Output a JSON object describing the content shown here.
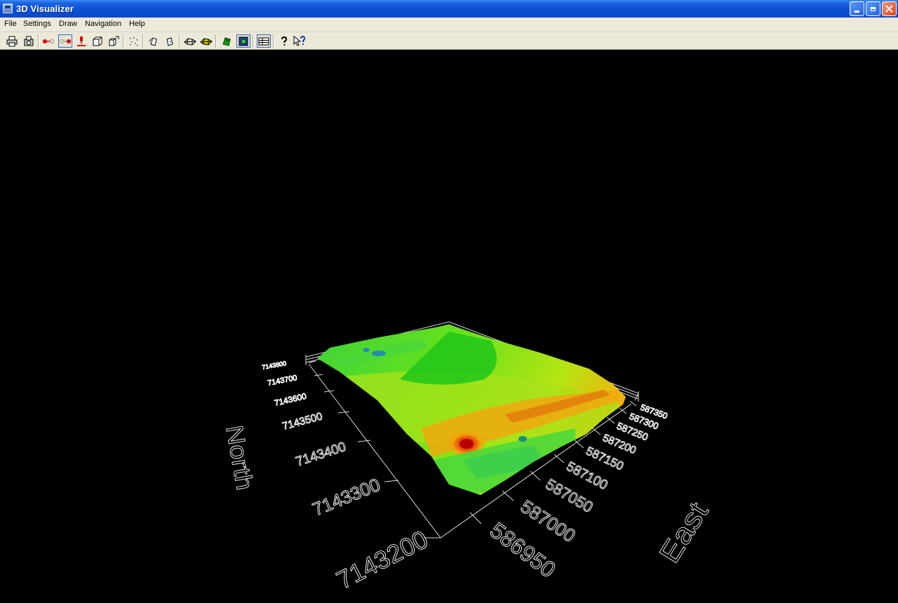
{
  "window": {
    "title": "3D Visualizer",
    "minimize_icon": "minimize-icon",
    "maximize_icon": "restore-icon",
    "close_icon": "close-icon"
  },
  "menu": [
    "File",
    "Settings",
    "Draw",
    "Navigation",
    "Help"
  ],
  "toolbar": [
    "print-icon",
    "print-preview-icon",
    "point-pair-icon",
    "point-pair-toggle-icon",
    "marker-pin-icon",
    "cube-icon",
    "cube-rotate-icon",
    "scatter-points-icon",
    "rotate-left-icon",
    "rotate-right-icon",
    "mesh-icon",
    "mesh-color-icon",
    "green-surface-icon",
    "color-surface-icon",
    "layers-icon",
    "help-icon",
    "context-help-icon"
  ],
  "plot": {
    "north_axis_title": "North",
    "east_axis_title": "East",
    "north_ticks": [
      "7143200",
      "7143300",
      "7143400",
      "7143500",
      "7143600",
      "7143700",
      "7143800"
    ],
    "east_ticks": [
      "586950",
      "587000",
      "587050",
      "587100",
      "587150",
      "587200",
      "587250",
      "587300",
      "587350"
    ]
  }
}
